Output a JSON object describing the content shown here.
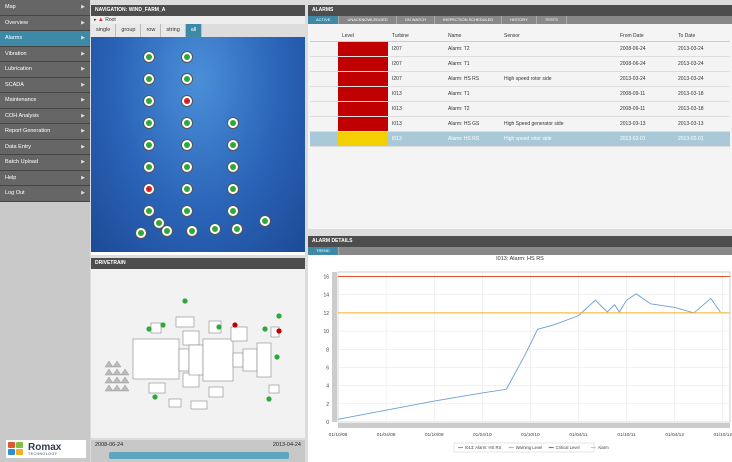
{
  "menu": [
    {
      "label": "Map",
      "active": false
    },
    {
      "label": "Overview",
      "active": false
    },
    {
      "label": "Alarms",
      "active": true
    },
    {
      "label": "Vibration",
      "active": false
    },
    {
      "label": "Lubrication",
      "active": false
    },
    {
      "label": "SCADA",
      "active": false
    },
    {
      "label": "Maintenance",
      "active": false
    },
    {
      "label": "COH Analysis",
      "active": false
    },
    {
      "label": "Report Generation",
      "active": false
    },
    {
      "label": "Data Entry",
      "active": false
    },
    {
      "label": "Batch Upload",
      "active": false
    },
    {
      "label": "Help",
      "active": false
    },
    {
      "label": "Log Out",
      "active": false
    }
  ],
  "logo": {
    "name": "Romax",
    "sub": "TECHNOLOGY"
  },
  "navigation": {
    "title": "NAVIGATION: WIND_FARM_A",
    "root": "Root",
    "tabs": [
      {
        "label": "single",
        "active": false
      },
      {
        "label": "group",
        "active": false
      },
      {
        "label": "row",
        "active": false
      },
      {
        "label": "string",
        "active": false
      },
      {
        "label": "all",
        "active": true
      }
    ]
  },
  "drivetrain": {
    "title": "DRIVETRAIN"
  },
  "timeline": {
    "start": "2008-06-24",
    "end": "2013-04-24"
  },
  "alarms": {
    "title": "ALARMS",
    "tabs": [
      {
        "label": "Active",
        "active": true
      },
      {
        "label": "Unacknowledged",
        "active": false
      },
      {
        "label": "On Watch",
        "active": false
      },
      {
        "label": "Inspection Scheduled",
        "active": false
      },
      {
        "label": "History",
        "active": false
      },
      {
        "label": "Tests",
        "active": false
      }
    ],
    "columns": [
      "Level",
      "Turbine",
      "Name",
      "Sensor",
      "From Date",
      "To Date"
    ],
    "rows": [
      {
        "level": "#c00000",
        "turbine": "I207",
        "name": "Alarm: T2",
        "sensor": "",
        "from": "2008-06-24",
        "to": "2013-03-24",
        "selected": false
      },
      {
        "level": "#c00000",
        "turbine": "I207",
        "name": "Alarm: T1",
        "sensor": "",
        "from": "2008-06-24",
        "to": "2013-03-24",
        "selected": false
      },
      {
        "level": "#c00000",
        "turbine": "I207",
        "name": "Alarm: HS RS",
        "sensor": "High speed rotor side",
        "from": "2013-03-24",
        "to": "2013-03-24",
        "selected": false
      },
      {
        "level": "#c00000",
        "turbine": "I013",
        "name": "Alarm: T1",
        "sensor": "",
        "from": "2008-09-11",
        "to": "2013-03-18",
        "selected": false
      },
      {
        "level": "#c00000",
        "turbine": "I013",
        "name": "Alarm: T2",
        "sensor": "",
        "from": "2008-09-11",
        "to": "2013-03-18",
        "selected": false
      },
      {
        "level": "#c00000",
        "turbine": "I013",
        "name": "Alarm: HS GS",
        "sensor": "High Speed generator side",
        "from": "2013-03-13",
        "to": "2013-03-13",
        "selected": false
      },
      {
        "level": "#f5d000",
        "turbine": "I013",
        "name": "Alarm: HS RS",
        "sensor": "High speed rotor side",
        "from": "2013-02-01",
        "to": "2013-02-01",
        "selected": true
      }
    ]
  },
  "details": {
    "title": "ALARM DETAILS",
    "tab": "Trend"
  },
  "chart_data": {
    "type": "line",
    "title": "I013: Alarm: HS RS",
    "x_ticks": [
      "01/10/08",
      "01/04/09",
      "01/10/09",
      "01/04/10",
      "01/10/10",
      "01/04/11",
      "01/10/11",
      "01/04/12",
      "01/10/12"
    ],
    "y_ticks": [
      0,
      2,
      4,
      6,
      8,
      10,
      12,
      14,
      16
    ],
    "ylim": [
      0,
      16.5
    ],
    "series": [
      {
        "name": "I013: Alarm: HS RS",
        "color": "#6a9fd9",
        "x": [
          0,
          1,
          2,
          3,
          3.5,
          3.9,
          4.15,
          4.5,
          5.0,
          5.35,
          5.6,
          5.75,
          5.85,
          6.0,
          6.2,
          6.5,
          7.0,
          7.4,
          7.75,
          7.95
        ],
        "y": [
          0.3,
          1.3,
          2.3,
          3.2,
          3.6,
          7.5,
          10.2,
          10.7,
          11.7,
          13.4,
          12.1,
          12.9,
          12.1,
          13.4,
          14.1,
          13.0,
          12.6,
          12.0,
          13.6,
          12.1
        ]
      },
      {
        "name": "Warning Level",
        "color": "#f2b120",
        "constant": 12.0
      },
      {
        "name": "Critical Level",
        "color": "#e8502a",
        "constant": 16.0
      }
    ],
    "legend": [
      "I013: Alarm: HS RS",
      "Warning Level",
      "Critical Level",
      "Alarm"
    ],
    "grid": true
  }
}
